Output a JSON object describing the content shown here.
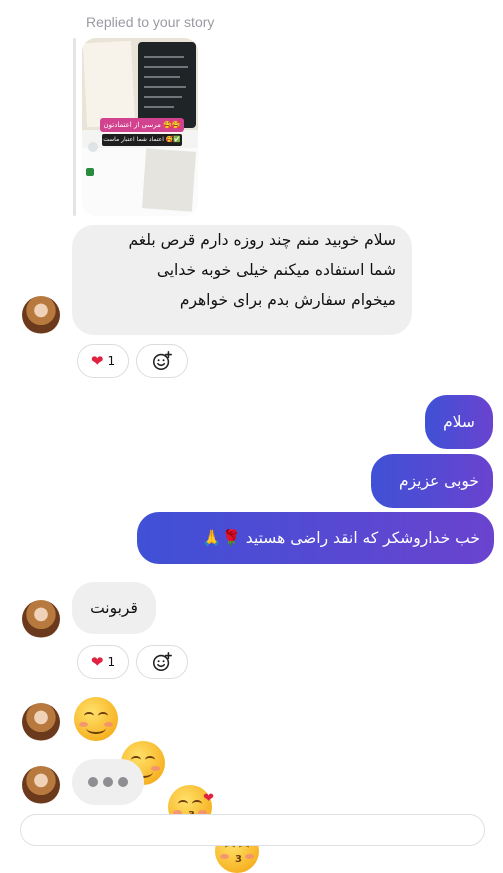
{
  "reply_header": "Replied to your story",
  "story_thumbnail": {
    "banner_line1": "مرسی از اعتمادتون 🥰🥰",
    "banner_line2": "اعتماد شما اعتبار ماست 🥰✅"
  },
  "messages": [
    {
      "from": "other",
      "lines": [
        "سلام خوبید منم چند روزه دارم قرص بلغم",
        "شما استفاده میکنم خیلی خوبه خدایی",
        "میخوام سفارش بدم  برای خواهرم"
      ],
      "reaction": {
        "emoji": "❤",
        "count": "1"
      }
    },
    {
      "from": "me",
      "text": "سلام"
    },
    {
      "from": "me",
      "text": "خوبی عزیزم"
    },
    {
      "from": "me",
      "text": "خب خداروشکر که انقد راضی هستید 🌹🙏"
    },
    {
      "from": "other",
      "text": "قربونت",
      "reaction": {
        "emoji": "❤",
        "count": "1"
      }
    },
    {
      "from": "other",
      "emojis": [
        "blush-face-icon",
        "blush-face-icon",
        "kiss-face-icon",
        "kiss-face-icon"
      ]
    },
    {
      "from": "other",
      "typing": true
    }
  ],
  "colors": {
    "outgoing_start": "#3f51d6",
    "outgoing_end": "#6a43cf",
    "incoming": "#efefef",
    "heart": "#e0213f"
  }
}
